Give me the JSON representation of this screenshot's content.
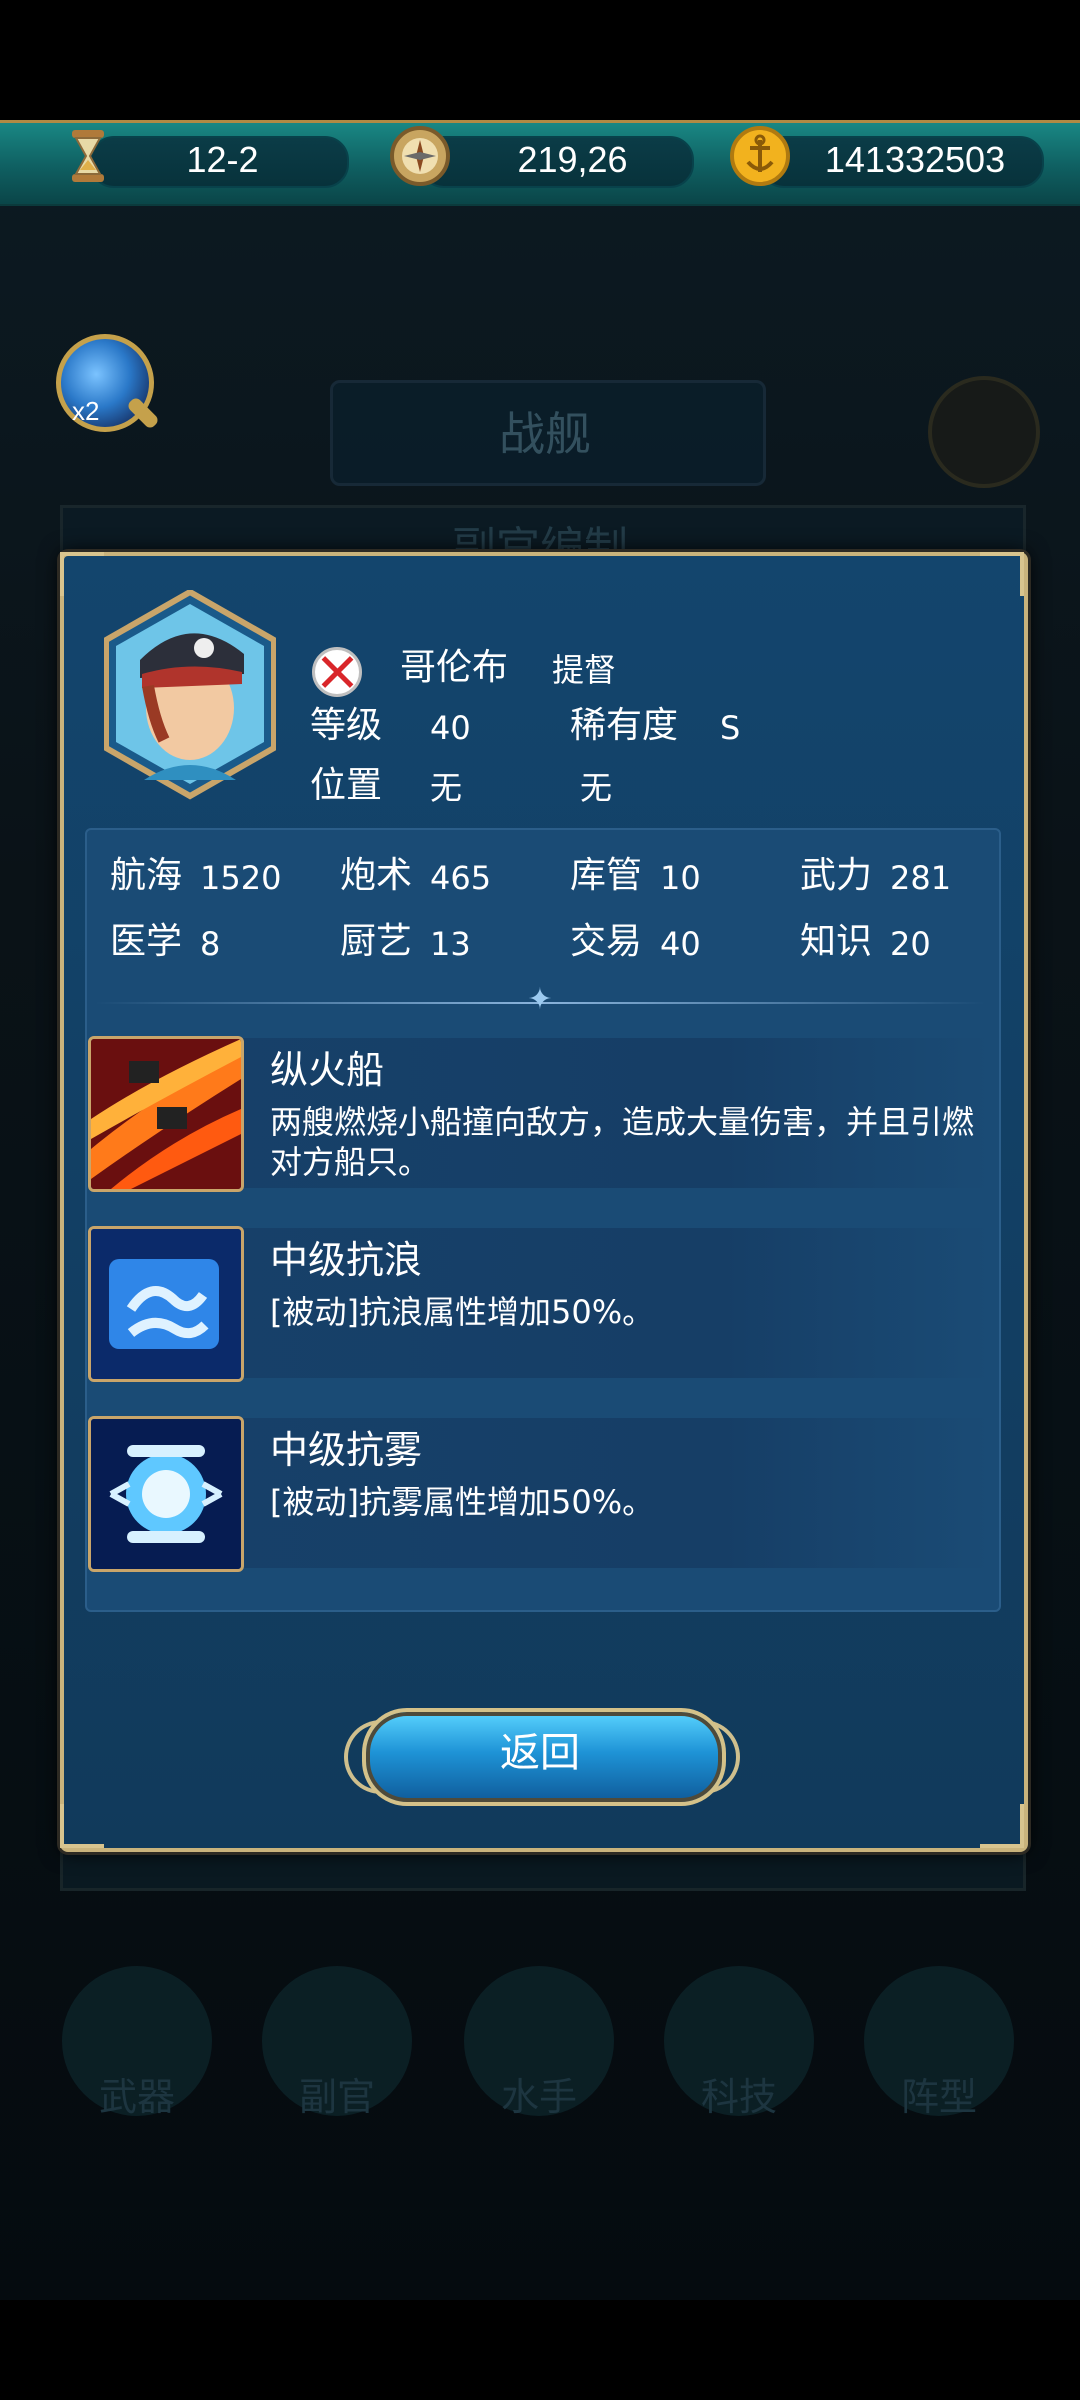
{
  "topbar": {
    "stage": "12-2",
    "compass_value": "219,26",
    "gold": "141332503",
    "icons": [
      "hourglass-icon",
      "compass-icon",
      "anchor-coin-icon"
    ]
  },
  "search": {
    "multiplier": "x2"
  },
  "background": {
    "title": "战舰",
    "panel_title": "副官编制",
    "nav": [
      "武器",
      "副官",
      "水手",
      "科技",
      "阵型"
    ]
  },
  "officer": {
    "name": "哥伦布",
    "rank": "提督",
    "level_label": "等级",
    "level": "40",
    "rarity_label": "稀有度",
    "rarity": "S",
    "position_label": "位置",
    "position": "无",
    "position2": "无"
  },
  "stats": [
    {
      "label": "航海",
      "value": "1520"
    },
    {
      "label": "炮术",
      "value": "465"
    },
    {
      "label": "库管",
      "value": "10"
    },
    {
      "label": "武力",
      "value": "281"
    },
    {
      "label": "医学",
      "value": "8"
    },
    {
      "label": "厨艺",
      "value": "13"
    },
    {
      "label": "交易",
      "value": "40"
    },
    {
      "label": "知识",
      "value": "20"
    }
  ],
  "skills": [
    {
      "name": "纵火船",
      "desc": "两艘燃烧小船撞向敌方，造成大量伤害，并且引燃对方船只。",
      "icon": "fire-ship-icon"
    },
    {
      "name": "中级抗浪",
      "desc": "[被动]抗浪属性增加50%。",
      "icon": "wave-resist-icon"
    },
    {
      "name": "中级抗雾",
      "desc": "[被动]抗雾属性增加50%。",
      "icon": "fog-resist-icon"
    }
  ],
  "buttons": {
    "return_label": "返回"
  }
}
